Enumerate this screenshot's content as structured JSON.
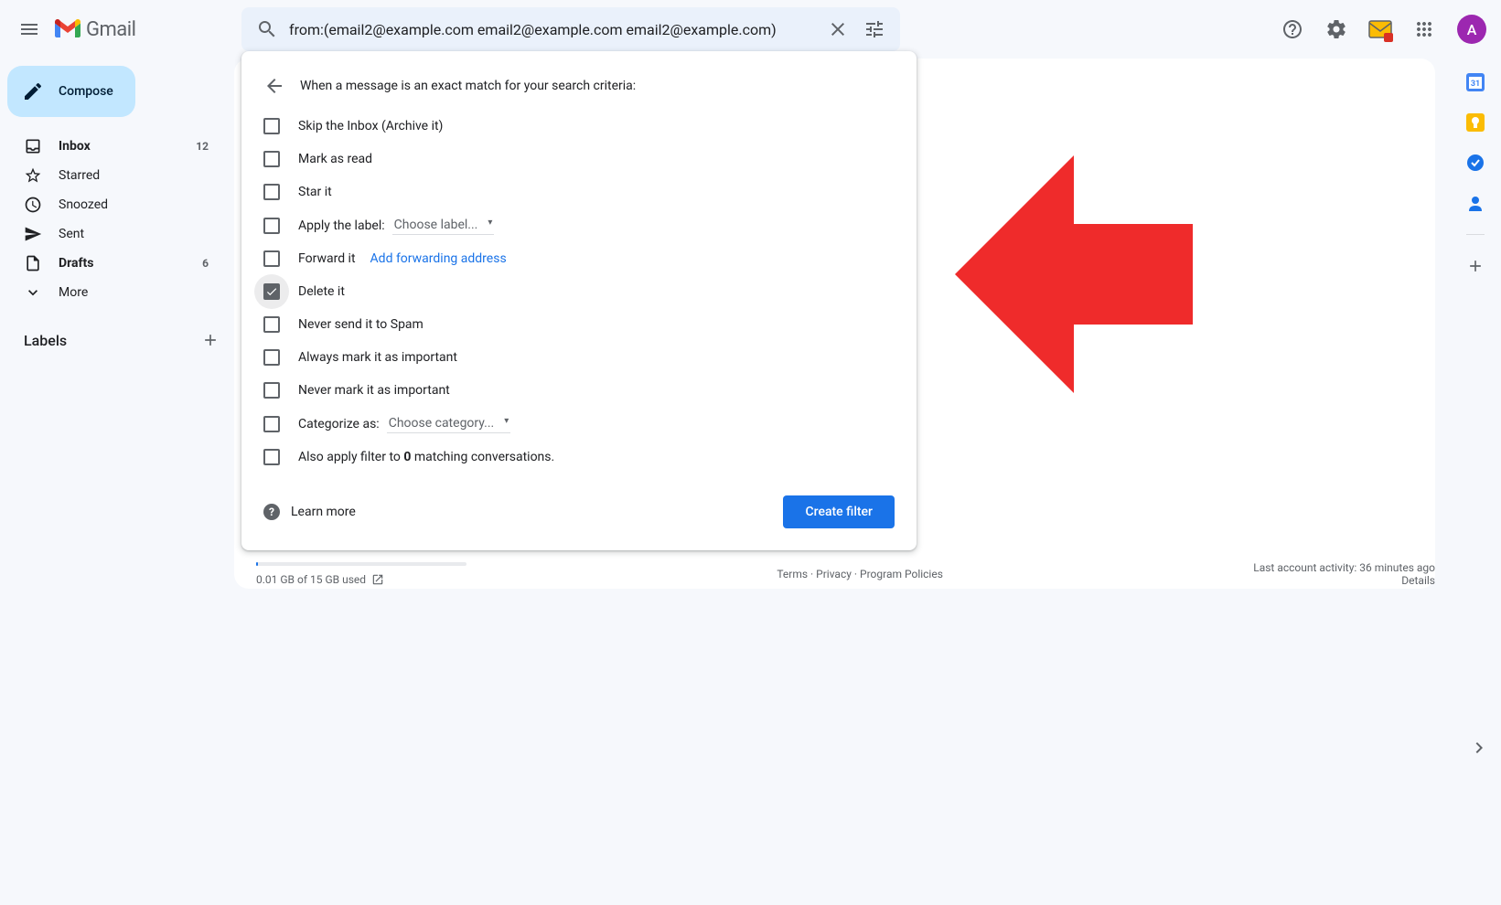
{
  "app_name": "Gmail",
  "search": {
    "query": "from:(email2@example.com email2@example.com email2@example.com)"
  },
  "avatar_initial": "A",
  "compose_label": "Compose",
  "sidebar_items": [
    {
      "icon": "inbox",
      "label": "Inbox",
      "count": "12",
      "bold": true
    },
    {
      "icon": "star",
      "label": "Starred",
      "count": ""
    },
    {
      "icon": "clock",
      "label": "Snoozed",
      "count": ""
    },
    {
      "icon": "send",
      "label": "Sent",
      "count": ""
    },
    {
      "icon": "file",
      "label": "Drafts",
      "count": "6",
      "bold": true
    },
    {
      "icon": "chevron-down",
      "label": "More",
      "count": ""
    }
  ],
  "labels_heading": "Labels",
  "filter": {
    "heading": "When a message is an exact match for your search criteria:",
    "options": [
      {
        "label": "Skip the Inbox (Archive it)",
        "checked": false
      },
      {
        "label": "Mark as read",
        "checked": false
      },
      {
        "label": "Star it",
        "checked": false
      },
      {
        "label": "Apply the label:",
        "checked": false,
        "select": "Choose label..."
      },
      {
        "label": "Forward it",
        "checked": false,
        "link": "Add forwarding address"
      },
      {
        "label": "Delete it",
        "checked": true,
        "focused": true
      },
      {
        "label": "Never send it to Spam",
        "checked": false
      },
      {
        "label": "Always mark it as important",
        "checked": false
      },
      {
        "label": "Never mark it as important",
        "checked": false
      },
      {
        "label": "Categorize as:",
        "checked": false,
        "select": "Choose category..."
      }
    ],
    "also_apply_prefix": "Also apply filter to ",
    "also_apply_count": "0",
    "also_apply_suffix": " matching conversations.",
    "learn_more": "Learn more",
    "create_button": "Create filter"
  },
  "footer": {
    "storage_text": "0.01 GB of 15 GB used",
    "links": {
      "terms": "Terms",
      "privacy": "Privacy",
      "policies": "Program Policies"
    },
    "activity_line": "Last account activity: 36 minutes ago",
    "details": "Details"
  }
}
